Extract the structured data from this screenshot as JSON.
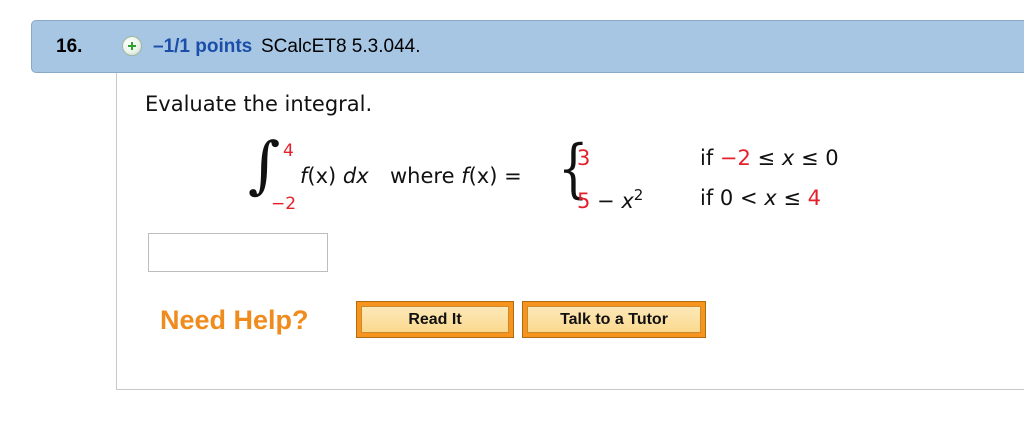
{
  "header": {
    "question_number": "16.",
    "points": "–1/1 points",
    "source": "SCalcET8 5.3.044."
  },
  "question": {
    "prompt": "Evaluate the integral.",
    "integral": {
      "upper": "4",
      "lower": "−2",
      "integrand_f": "f",
      "integrand_x": "(x) ",
      "integrand_d": "dx",
      "where": " where ",
      "f_name": "f",
      "f_arg": "(x) = "
    },
    "cases": [
      {
        "value_a": "3",
        "value_b": "",
        "value_c": "",
        "cond_if": "if ",
        "cond_left": "−2",
        "cond_mid": " ≤ ",
        "cond_var": "x",
        "cond_rel": " ≤ ",
        "cond_right": "0"
      },
      {
        "value_a": "5",
        "value_b": " − ",
        "value_c": "x",
        "exp": "2",
        "cond_if": "if ",
        "cond_left": "0",
        "cond_mid": " < ",
        "cond_var": "x",
        "cond_rel": " ≤ ",
        "cond_right": "4"
      }
    ]
  },
  "answer": {
    "value": ""
  },
  "help": {
    "label": "Need Help?",
    "read_it": "Read It",
    "talk_to_tutor": "Talk to a Tutor"
  },
  "colors": {
    "header_bg": "#a7c6e3",
    "points_blue": "#1a4ea8",
    "math_red": "#e4212b",
    "need_help_orange": "#f08c1e",
    "button_orange": "#f7941d"
  }
}
